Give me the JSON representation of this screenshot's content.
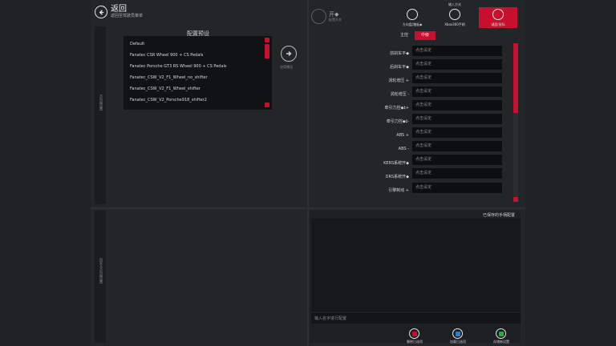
{
  "header": {
    "back_title": "返回",
    "back_subtitle": "返回至驾驶员菜单"
  },
  "left_panel": {
    "side_label_top": "方向盘设置",
    "side_label_bottom": "自定义方向盘设置",
    "preset_title": "配置预设",
    "presets": [
      "Default",
      "Fanatec CSR Wheel 900 + CS Pedals",
      "Fanatec Porsche GT3 RS Wheel 900 + CS Pedals",
      "Fanatec_CSW_V2_F1_Wheel_no_shifter",
      "Fanatec_CSW_V2_F1_Wheel_shifter",
      "Fanatec_CSW_V2_Porsche918_shifter2"
    ],
    "apply_label": "应用预设"
  },
  "right_panel": {
    "input_mode_label": "输入方式",
    "mode_title": "开◆",
    "mode_subtitle": "配置开关",
    "modes": [
      {
        "label": "方向盘/踏板◆",
        "active": false
      },
      {
        "label": "Xbox360手柄",
        "active": false
      },
      {
        "label": "键盘/鼠标",
        "active": true
      }
    ],
    "tabs": [
      "主控",
      "中级"
    ],
    "active_tab": "中级",
    "bindings": [
      {
        "label": "前刹车平◆",
        "value": "点击设定"
      },
      {
        "label": "后刹车平◆",
        "value": "点击设定"
      },
      {
        "label": "涡轮增压 +",
        "value": "点击设定"
      },
      {
        "label": "涡轮增压 -",
        "value": "点击设定"
      },
      {
        "label": "牵引力控◆‡+",
        "value": "点击设定"
      },
      {
        "label": "牵引力控◆‡-",
        "value": "点击设定"
      },
      {
        "label": "ABS +",
        "value": "点击设定"
      },
      {
        "label": "ABS -",
        "value": "点击设定"
      },
      {
        "label": "KERS系统开◆",
        "value": "点击设定"
      },
      {
        "label": "DRS系统开◆",
        "value": "点击设定"
      },
      {
        "label": "引擎制动 +",
        "value": "点击设定"
      }
    ]
  },
  "saved_panel": {
    "title": "已保存的手柄配置",
    "name_placeholder": "输入名字进行配置",
    "actions": [
      {
        "label": "删除已选项",
        "color": "#c8102e"
      },
      {
        "label": "加载已选项",
        "color": "#2a7fd4"
      },
      {
        "label": "存储新设置",
        "color": "#2aa84a"
      }
    ]
  },
  "colors": {
    "accent": "#c8102e"
  }
}
